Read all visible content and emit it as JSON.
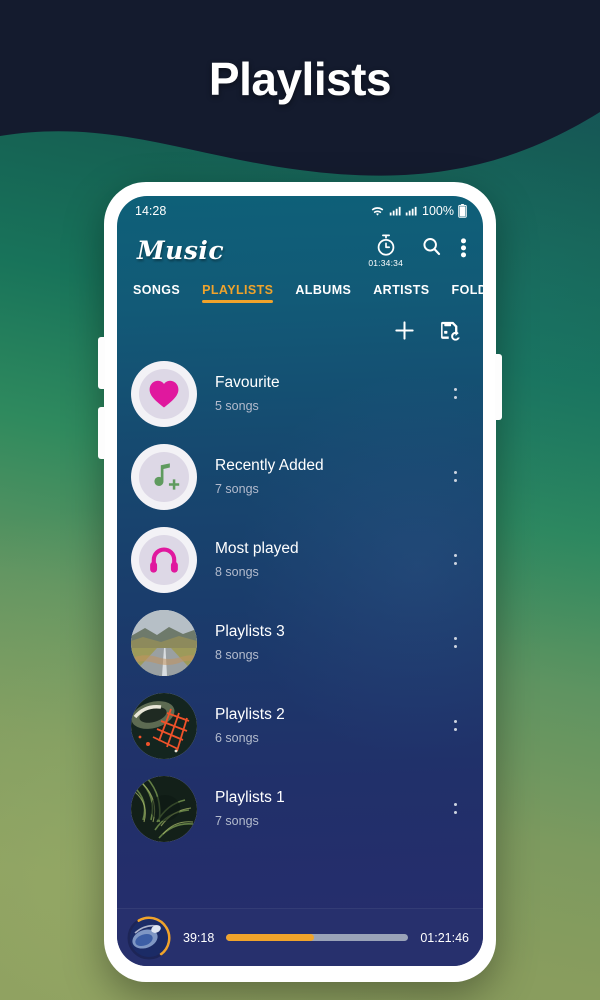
{
  "page": {
    "title": "Playlists",
    "theme": {
      "accent": "#f0a32b",
      "screen_top": "#0e6078",
      "screen_bottom": "#272c6d",
      "player_bg": "#27306d",
      "heart_pink": "#e0189e",
      "note_green": "#5f9b5f",
      "bg_dark": "#141b2e"
    }
  },
  "status_bar": {
    "time": "14:28",
    "battery_percent": "100%",
    "icons": [
      "wifi-icon",
      "signal-icon",
      "signal-icon",
      "battery-icon"
    ]
  },
  "app_bar": {
    "brand": "Music",
    "timer_label": "01:34:34",
    "actions": [
      {
        "name": "sleep-timer-button",
        "icon": "stopwatch-icon"
      },
      {
        "name": "search-button",
        "icon": "search-icon"
      },
      {
        "name": "overflow-menu-button",
        "icon": "more-vertical-icon"
      }
    ]
  },
  "tabs": [
    {
      "label": "SONGS",
      "active": false
    },
    {
      "label": "PLAYLISTS",
      "active": true
    },
    {
      "label": "ALBUMS",
      "active": false
    },
    {
      "label": "ARTISTS",
      "active": false
    },
    {
      "label": "FOLDERS",
      "active": false
    }
  ],
  "list_toolbar": [
    {
      "name": "add-playlist-button",
      "icon": "plus-icon"
    },
    {
      "name": "restore-playlist-button",
      "icon": "save-restore-icon"
    }
  ],
  "playlists": [
    {
      "title": "Favourite",
      "songs": "5 songs",
      "art": "heart-icon"
    },
    {
      "title": "Recently Added",
      "songs": "7 songs",
      "art": "note-plus-icon"
    },
    {
      "title": "Most played",
      "songs": "8 songs",
      "art": "headphones-icon"
    },
    {
      "title": "Playlists 3",
      "songs": "8 songs",
      "art": "photo-road"
    },
    {
      "title": "Playlists 2",
      "songs": "6 songs",
      "art": "photo-night-aerial"
    },
    {
      "title": "Playlists 1",
      "songs": "7 songs",
      "art": "photo-foliage"
    }
  ],
  "player": {
    "elapsed": "39:18",
    "total": "01:21:46",
    "progress_percent": 48
  }
}
